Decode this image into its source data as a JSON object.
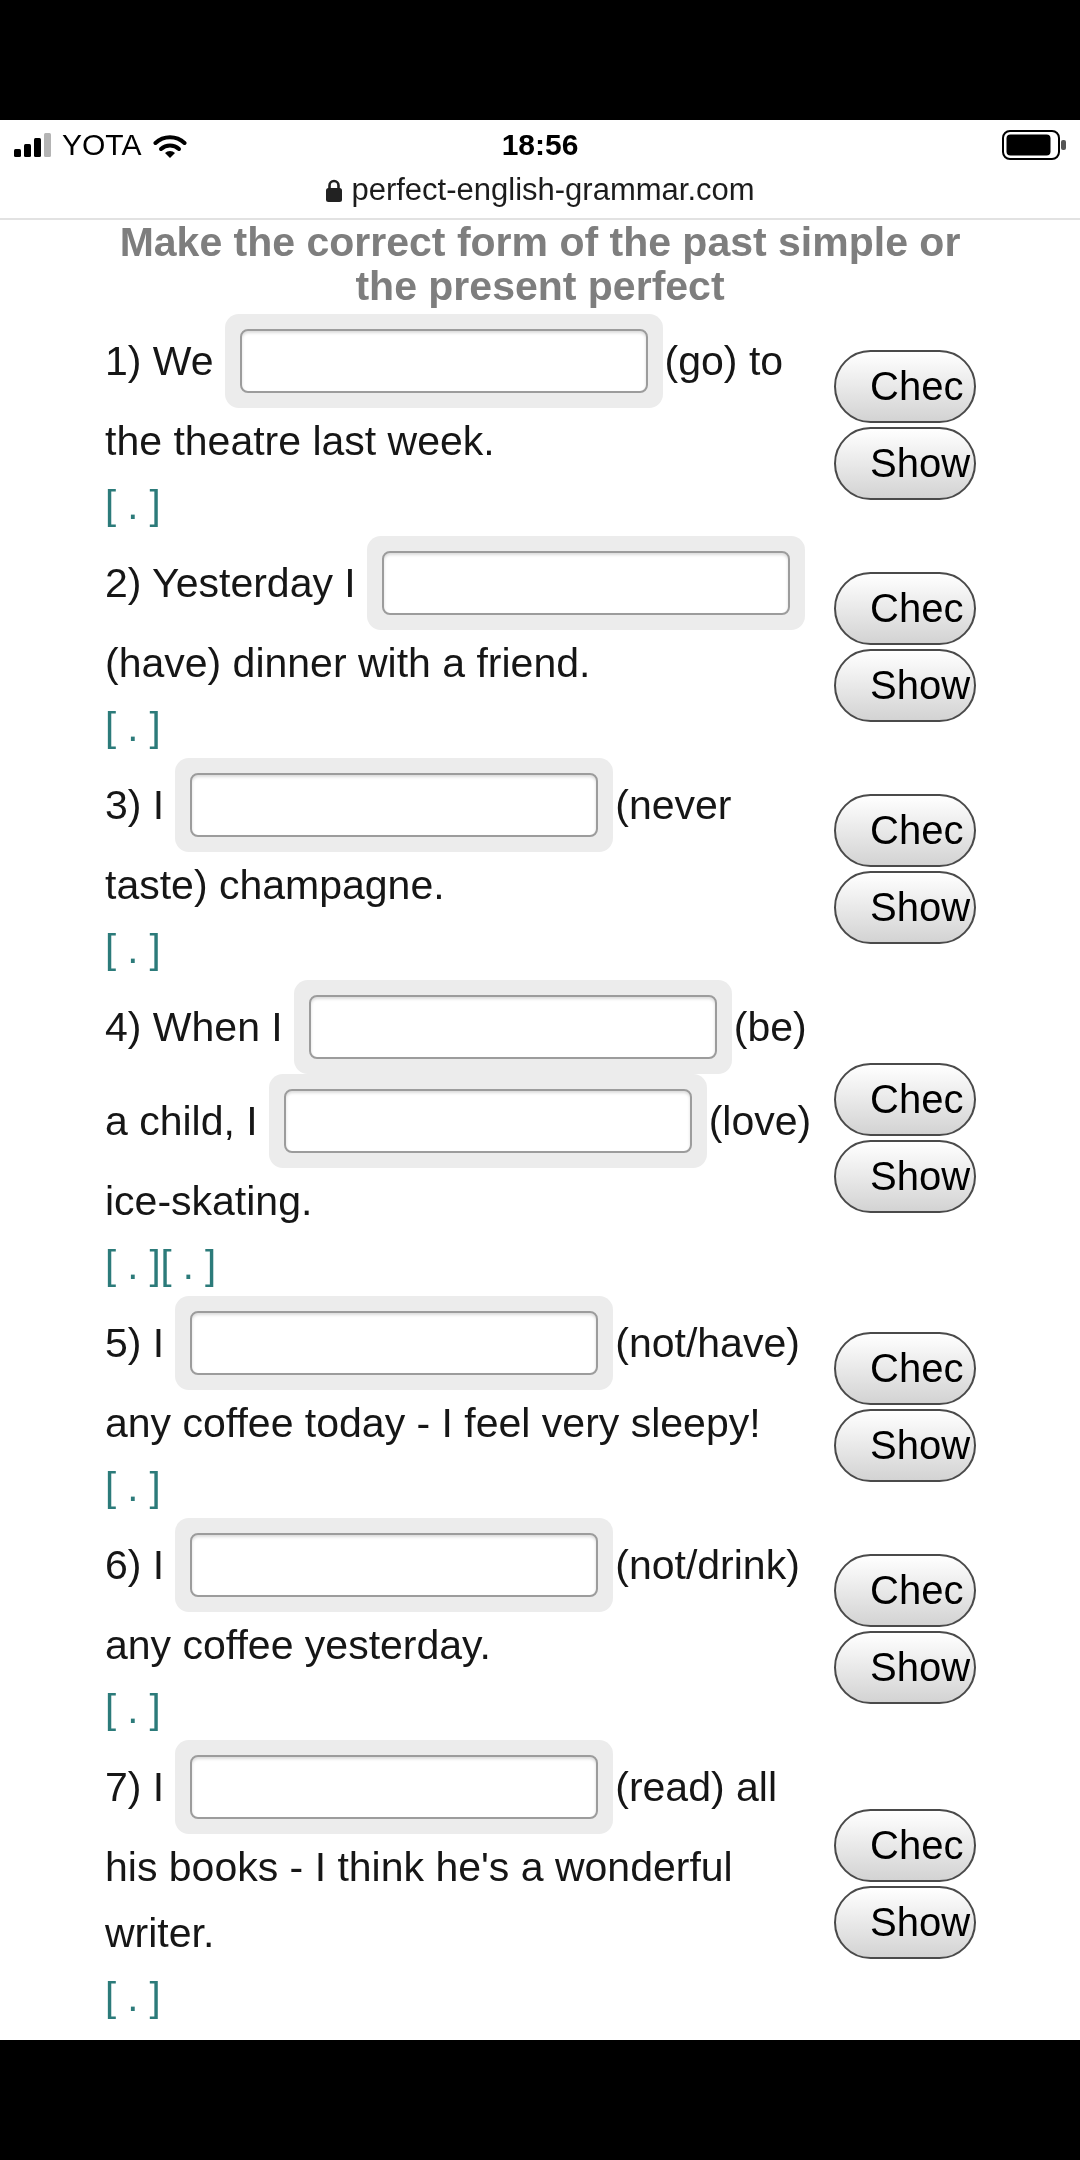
{
  "status_bar": {
    "carrier": "YOTA",
    "time": "18:56"
  },
  "address_bar": {
    "url": "perfect-english-grammar.com"
  },
  "heading": "Make the correct form of the past simple or the present perfect",
  "exercises": [
    {
      "lines": [
        {
          "parts": [
            {
              "kind": "text",
              "text": "1) We"
            },
            {
              "kind": "blank"
            },
            {
              "kind": "text",
              "text": "(go) to"
            }
          ]
        },
        {
          "parts": [
            {
              "kind": "text",
              "text": "the theatre last week."
            }
          ]
        }
      ],
      "hint_links": [
        "[ . ]"
      ],
      "buttons": [
        "Chec",
        "Show"
      ]
    },
    {
      "lines": [
        {
          "parts": [
            {
              "kind": "text",
              "text": "2) Yesterday I"
            },
            {
              "kind": "blank"
            }
          ]
        },
        {
          "parts": [
            {
              "kind": "text",
              "text": "(have) dinner with a friend."
            }
          ]
        }
      ],
      "hint_links": [
        "[ . ]"
      ],
      "buttons": [
        "Chec",
        "Show"
      ]
    },
    {
      "lines": [
        {
          "parts": [
            {
              "kind": "text",
              "text": "3) I"
            },
            {
              "kind": "blank"
            },
            {
              "kind": "text",
              "text": "(never"
            }
          ]
        },
        {
          "parts": [
            {
              "kind": "text",
              "text": "taste) champagne."
            }
          ]
        }
      ],
      "hint_links": [
        "[ . ]"
      ],
      "buttons": [
        "Chec",
        "Show"
      ]
    },
    {
      "lines": [
        {
          "parts": [
            {
              "kind": "text",
              "text": "4) When I"
            },
            {
              "kind": "blank"
            },
            {
              "kind": "text",
              "text": "(be)"
            }
          ]
        },
        {
          "parts": [
            {
              "kind": "text",
              "text": "a child, I"
            },
            {
              "kind": "blank"
            },
            {
              "kind": "text",
              "text": "(love)"
            }
          ]
        },
        {
          "parts": [
            {
              "kind": "text",
              "text": "ice-skating."
            }
          ]
        }
      ],
      "hint_links": [
        "[ . ]",
        "[ . ]"
      ],
      "buttons": [
        "Chec",
        "Show"
      ]
    },
    {
      "lines": [
        {
          "parts": [
            {
              "kind": "text",
              "text": "5) I"
            },
            {
              "kind": "blank"
            },
            {
              "kind": "text",
              "text": "(not/have)"
            }
          ]
        },
        {
          "parts": [
            {
              "kind": "text",
              "text": "any coffee today - I feel very sleepy!"
            }
          ]
        }
      ],
      "hint_links": [
        "[ . ]"
      ],
      "buttons": [
        "Chec",
        "Show"
      ]
    },
    {
      "lines": [
        {
          "parts": [
            {
              "kind": "text",
              "text": "6) I"
            },
            {
              "kind": "blank"
            },
            {
              "kind": "text",
              "text": "(not/drink)"
            }
          ]
        },
        {
          "parts": [
            {
              "kind": "text",
              "text": "any coffee yesterday."
            }
          ]
        }
      ],
      "hint_links": [
        "[ . ]"
      ],
      "buttons": [
        "Chec",
        "Show"
      ]
    },
    {
      "lines": [
        {
          "parts": [
            {
              "kind": "text",
              "text": "7) I"
            },
            {
              "kind": "blank"
            },
            {
              "kind": "text",
              "text": "(read) all"
            }
          ]
        },
        {
          "parts": [
            {
              "kind": "text",
              "text": "his books - I think he's a wonderful"
            }
          ]
        },
        {
          "parts": [
            {
              "kind": "text",
              "text": "writer."
            }
          ]
        }
      ],
      "hint_links": [
        "[ . ]"
      ],
      "buttons": [
        "Chec",
        "Show"
      ]
    }
  ]
}
